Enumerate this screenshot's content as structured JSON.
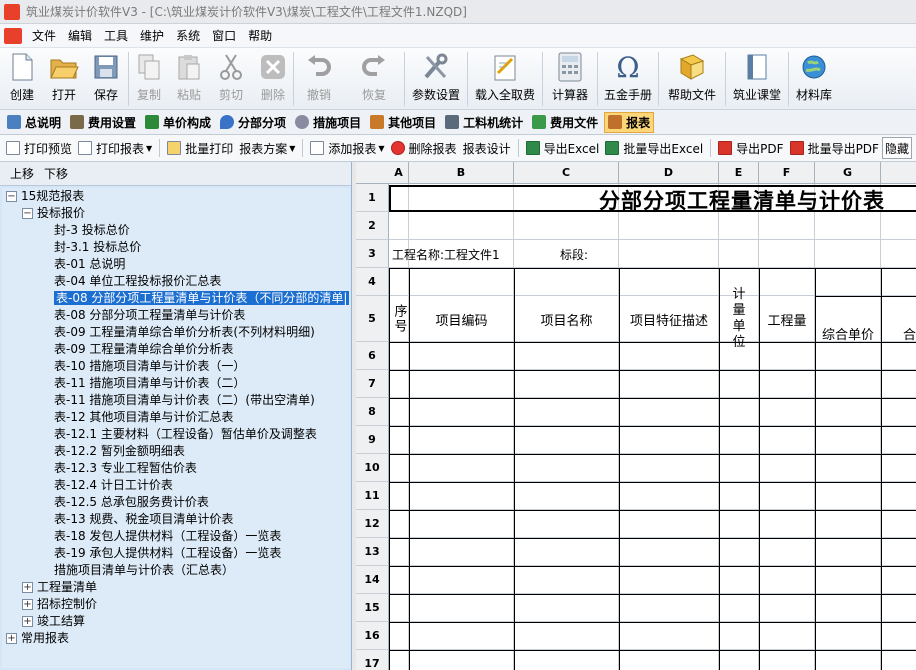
{
  "window": {
    "title": "筑业煤炭计价软件V3 - [C:\\筑业煤炭计价软件V3\\煤炭\\工程文件\\工程文件1.NZQD]"
  },
  "menu": [
    "文件",
    "编辑",
    "工具",
    "维护",
    "系统",
    "窗口",
    "帮助"
  ],
  "toolbar": [
    {
      "label": "创建",
      "icon": "new-file-icon",
      "disabled": false
    },
    {
      "label": "打开",
      "icon": "folder-open-icon",
      "disabled": false
    },
    {
      "label": "保存",
      "icon": "save-disk-icon",
      "disabled": false
    },
    {
      "label": "复制",
      "icon": "copy-icon",
      "disabled": true
    },
    {
      "label": "粘贴",
      "icon": "paste-icon",
      "disabled": true
    },
    {
      "label": "剪切",
      "icon": "scissors-icon",
      "disabled": true
    },
    {
      "label": "删除",
      "icon": "delete-x-icon",
      "disabled": true
    },
    {
      "label": "撤销",
      "icon": "undo-icon",
      "disabled": true
    },
    {
      "label": "恢复",
      "icon": "redo-icon",
      "disabled": true
    },
    {
      "label": "参数设置",
      "icon": "tools-icon",
      "disabled": false
    },
    {
      "label": "载入全取费",
      "icon": "load-fee-icon",
      "disabled": false
    },
    {
      "label": "计算器",
      "icon": "calculator-icon",
      "disabled": false
    },
    {
      "label": "五金手册",
      "icon": "omega-icon",
      "disabled": false
    },
    {
      "label": "帮助文件",
      "icon": "help-book-icon",
      "disabled": false
    },
    {
      "label": "筑业课堂",
      "icon": "classroom-icon",
      "disabled": false
    },
    {
      "label": "材料库",
      "icon": "globe-icon",
      "disabled": false
    }
  ],
  "tabs": [
    {
      "label": "总说明",
      "color": "#4a7fc0"
    },
    {
      "label": "费用设置",
      "color": "#7a6a4a"
    },
    {
      "label": "单价构成",
      "color": "#2c8a3a"
    },
    {
      "label": "分部分项",
      "color": "#3a72c8"
    },
    {
      "label": "措施项目",
      "color": "#8a8aa0"
    },
    {
      "label": "其他项目",
      "color": "#c87a2a"
    },
    {
      "label": "工料机统计",
      "color": "#5a6a7a"
    },
    {
      "label": "费用文件",
      "color": "#3a9a4a"
    },
    {
      "label": "报表",
      "color": "#c0702a",
      "active": true
    }
  ],
  "actions": [
    {
      "label": "打印预览",
      "dropdown": false
    },
    {
      "label": "打印报表",
      "dropdown": true
    },
    {
      "label": "批量打印",
      "dropdown": false
    },
    {
      "label": "报表方案",
      "dropdown": true
    },
    {
      "label": "添加报表",
      "dropdown": true
    },
    {
      "label": "删除报表",
      "dropdown": false
    },
    {
      "label": "报表设计",
      "dropdown": false
    },
    {
      "label": "导出Excel",
      "dropdown": false
    },
    {
      "label": "批量导出Excel",
      "dropdown": false
    },
    {
      "label": "导出PDF",
      "dropdown": false
    },
    {
      "label": "批量导出PDF",
      "dropdown": false
    },
    {
      "label": "隐藏",
      "dropdown": false
    }
  ],
  "leftpanel": {
    "move_up": "上移",
    "move_down": "下移"
  },
  "tree": [
    {
      "label": "15规范报表",
      "level": 0,
      "expand": "-"
    },
    {
      "label": "投标报价",
      "level": 1,
      "expand": "-"
    },
    {
      "label": "封-3 投标总价",
      "level": 2
    },
    {
      "label": "封-3.1 投标总价",
      "level": 2
    },
    {
      "label": "表-01 总说明",
      "level": 2
    },
    {
      "label": "表-04 单位工程投标报价汇总表",
      "level": 2
    },
    {
      "label": "表-08 分部分项工程量清单与计价表（不同分部的清单|",
      "level": 2,
      "selected": true
    },
    {
      "label": "表-08 分部分项工程量清单与计价表",
      "level": 2
    },
    {
      "label": "表-09 工程量清单综合单价分析表(不列材料明细)",
      "level": 2
    },
    {
      "label": "表-09 工程量清单综合单价分析表",
      "level": 2
    },
    {
      "label": "表-10 措施项目清单与计价表（一）",
      "level": 2
    },
    {
      "label": "表-11 措施项目清单与计价表（二）",
      "level": 2
    },
    {
      "label": "表-11 措施项目清单与计价表（二）(带出空清单)",
      "level": 2
    },
    {
      "label": "表-12 其他项目清单与计价汇总表",
      "level": 2
    },
    {
      "label": "表-12.1 主要材料（工程设备）暂估单价及调整表",
      "level": 2
    },
    {
      "label": "表-12.2 暂列金额明细表",
      "level": 2
    },
    {
      "label": "表-12.3 专业工程暂估价表",
      "level": 2
    },
    {
      "label": "表-12.4 计日工计价表",
      "level": 2
    },
    {
      "label": "表-12.5 总承包服务费计价表",
      "level": 2
    },
    {
      "label": "表-13 规费、税金项目清单计价表",
      "level": 2
    },
    {
      "label": "表-18 发包人提供材料（工程设备）一览表",
      "level": 2
    },
    {
      "label": "表-19 承包人提供材料（工程设备）一览表",
      "level": 2
    },
    {
      "label": "措施项目清单与计价表（汇总表）",
      "level": 2
    },
    {
      "label": "工程量清单",
      "level": 1,
      "expand": "+"
    },
    {
      "label": "招标控制价",
      "level": 1,
      "expand": "+"
    },
    {
      "label": "竣工结算",
      "level": 1,
      "expand": "+"
    },
    {
      "label": "常用报表",
      "level": 0,
      "expand": "+"
    }
  ],
  "sheet": {
    "columns": [
      "A",
      "B",
      "C",
      "D",
      "E",
      "F",
      "G",
      ""
    ],
    "rows": [
      "1",
      "2",
      "3",
      "4",
      "5",
      "6",
      "7",
      "8",
      "9",
      "10",
      "11",
      "12",
      "13",
      "14",
      "15",
      "16",
      "17"
    ],
    "title": "分部分项工程量清单与计价表",
    "project_label": "工程名称:工程文件1",
    "section_label": "标段:",
    "headers": {
      "seq": "序号",
      "code": "项目编码",
      "name": "项目名称",
      "feature": "项目特征描述",
      "unit": "计量单位",
      "qty": "工程量",
      "unit_price": "综合单价",
      "total": "合"
    }
  }
}
